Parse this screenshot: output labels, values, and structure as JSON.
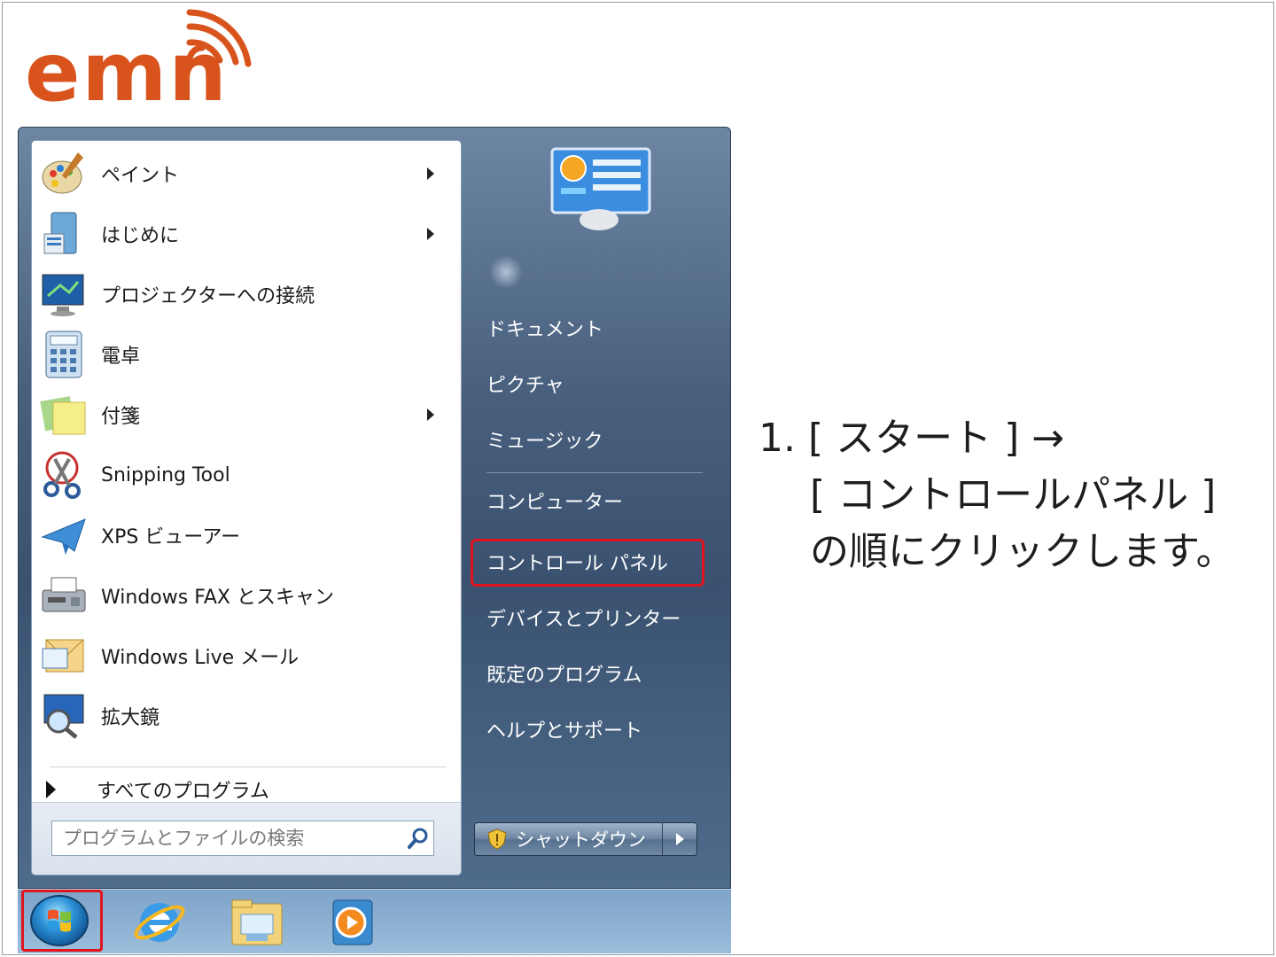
{
  "brand": {
    "logo_text": "emn",
    "color": "#d9541d"
  },
  "start_menu": {
    "programs": [
      {
        "label": "ペイント",
        "icon": "paint-icon",
        "has_submenu": true
      },
      {
        "label": "はじめに",
        "icon": "getting-started-icon",
        "has_submenu": true
      },
      {
        "label": "プロジェクターへの接続",
        "icon": "projector-icon",
        "has_submenu": false
      },
      {
        "label": "電卓",
        "icon": "calculator-icon",
        "has_submenu": false
      },
      {
        "label": "付箋",
        "icon": "sticky-notes-icon",
        "has_submenu": true
      },
      {
        "label": "Snipping Tool",
        "icon": "scissors-icon",
        "has_submenu": false
      },
      {
        "label": "XPS ビューアー",
        "icon": "xps-viewer-icon",
        "has_submenu": false
      },
      {
        "label": "Windows FAX とスキャン",
        "icon": "fax-icon",
        "has_submenu": false
      },
      {
        "label": "Windows Live メール",
        "icon": "mail-icon",
        "has_submenu": false
      },
      {
        "label": "拡大鏡",
        "icon": "magnifier-icon",
        "has_submenu": false
      }
    ],
    "all_programs": "すべてのプログラム",
    "search": {
      "placeholder": "プログラムとファイルの検索",
      "value": ""
    },
    "right_items": {
      "documents": "ドキュメント",
      "pictures": "ピクチャ",
      "music": "ミュージック",
      "computer": "コンピューター",
      "control_panel": "コントロール パネル",
      "devices": "デバイスとプリンター",
      "default_programs": "既定のプログラム",
      "help": "ヘルプとサポート"
    },
    "shutdown": "シャットダウン",
    "highlight_color": "#e0141e"
  },
  "instructions": {
    "line1": "1. [ スタート ] →",
    "line2": "[ コントロールパネル ]",
    "line3": "の順にクリックします。"
  }
}
